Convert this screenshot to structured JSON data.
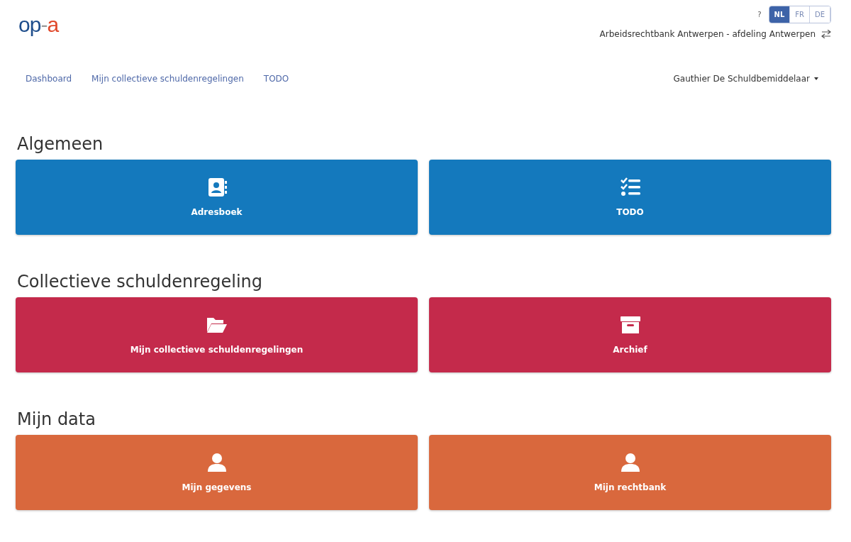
{
  "logo": {
    "parts": [
      {
        "text": "op",
        "color": "#1f4e8c"
      },
      {
        "text": "-",
        "color": "#9a9a9a"
      },
      {
        "text": "a",
        "color": "#e0482a"
      }
    ]
  },
  "help": "?",
  "languages": [
    {
      "label": "NL",
      "selected": true
    },
    {
      "label": "FR",
      "selected": false
    },
    {
      "label": "DE",
      "selected": false
    }
  ],
  "court": "Arbeidsrechtbank Antwerpen - afdeling Antwerpen",
  "nav": {
    "items": [
      "Dashboard",
      "Mijn collectieve schuldenregelingen",
      "TODO"
    ],
    "user": "Gauthier De Schuldbemiddelaar"
  },
  "sections": [
    {
      "title": "Algemeen",
      "color": "#1479bd",
      "tiles": [
        {
          "label": "Adresboek",
          "kind": "addressbook"
        },
        {
          "label": "TODO",
          "kind": "checklist"
        }
      ]
    },
    {
      "title": "Collectieve schuldenregeling",
      "color": "#c42a4b",
      "tiles": [
        {
          "label": "Mijn collectieve schuldenregelingen",
          "kind": "folder"
        },
        {
          "label": "Archief",
          "kind": "archive"
        }
      ]
    },
    {
      "title": "Mijn data",
      "color": "#d9683d",
      "tiles": [
        {
          "label": "Mijn gegevens",
          "kind": "user"
        },
        {
          "label": "Mijn rechtbank",
          "kind": "user"
        }
      ]
    }
  ]
}
